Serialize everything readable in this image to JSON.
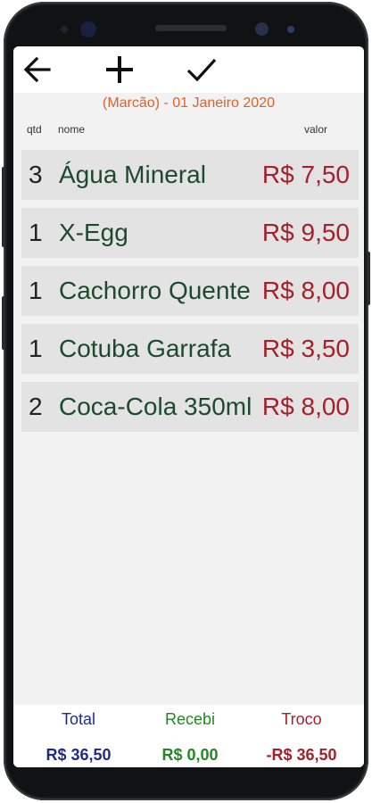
{
  "toolbar": {
    "back_icon": "arrow-left-icon",
    "add_icon": "plus-icon",
    "confirm_icon": "check-icon"
  },
  "date_line": "(Marcão) - 01 Janeiro 2020",
  "headers": {
    "qtd": "qtd",
    "nome": "nome",
    "valor": "valor"
  },
  "items": [
    {
      "qtd": "3",
      "nome": "Água Mineral",
      "valor": "R$ 7,50"
    },
    {
      "qtd": "1",
      "nome": "X-Egg",
      "valor": "R$ 9,50"
    },
    {
      "qtd": "1",
      "nome": "Cachorro Quente",
      "valor": "R$ 8,00"
    },
    {
      "qtd": "1",
      "nome": "Cotuba Garrafa",
      "valor": "R$ 3,50"
    },
    {
      "qtd": "2",
      "nome": "Coca-Cola 350ml",
      "valor": "R$ 8,00"
    }
  ],
  "footer": {
    "total_label": "Total",
    "recebi_label": "Recebi",
    "troco_label": "Troco",
    "total_value": "R$ 36,50",
    "recebi_value": "R$ 0,00",
    "troco_value": "-R$ 36,50"
  },
  "colors": {
    "date": "#e0622b",
    "item_name": "#1d4a2e",
    "item_value": "#a5202a",
    "total": "#1f2a8f",
    "recebi": "#1f8a1f",
    "troco": "#a5202a"
  }
}
